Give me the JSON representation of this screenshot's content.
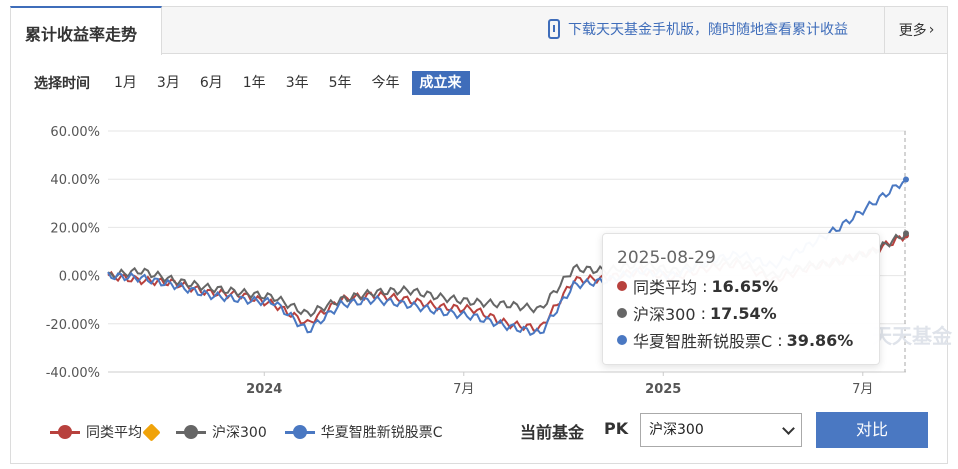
{
  "header": {
    "tab_title": "累计收益率走势",
    "promo_text": "下载天天基金手机版，随时随地查看累计收益",
    "more_label": "更多"
  },
  "range": {
    "label": "选择时间",
    "options": [
      "1月",
      "3月",
      "6月",
      "1年",
      "3年",
      "5年",
      "今年",
      "成立来"
    ],
    "active": "成立来"
  },
  "tooltip": {
    "date": "2025-08-29",
    "rows": [
      {
        "name": "同类平均",
        "value": "16.65%"
      },
      {
        "name": "沪深300",
        "value": "17.54%"
      },
      {
        "name": "华夏智胜新锐股票C",
        "value": "39.86%"
      }
    ]
  },
  "watermark": "天天基金",
  "legend": [
    "同类平均",
    "沪深300",
    "华夏智胜新锐股票C"
  ],
  "compare": {
    "label": "当前基金",
    "pk": "PK",
    "selected": "沪深300",
    "button": "对比"
  },
  "colors": {
    "category_avg": "#b8413d",
    "hs300": "#666666",
    "fund": "#4a78c2",
    "accent": "#3f6dba"
  },
  "chart_data": {
    "type": "line",
    "y_ticks": [
      "60.00%",
      "40.00%",
      "20.00%",
      "0.00%",
      "-20.00%",
      "-40.00%"
    ],
    "x_ticks": [
      "2024",
      "7月",
      "2025",
      "7月"
    ],
    "ylim": [
      -40,
      60
    ],
    "x": [
      "2023-08",
      "2023-09",
      "2023-10",
      "2023-11",
      "2023-12",
      "2024-01",
      "2024-02",
      "2024-03",
      "2024-04",
      "2024-05",
      "2024-06",
      "2024-07",
      "2024-08",
      "2024-09",
      "2024-10",
      "2024-11",
      "2024-12",
      "2025-01",
      "2025-02",
      "2025-03",
      "2025-04",
      "2025-05",
      "2025-06",
      "2025-07",
      "2025-08-29"
    ],
    "series": [
      {
        "name": "同类平均",
        "values": [
          0,
          -2,
          -3,
          -7,
          -8,
          -12,
          -20,
          -10,
          -8,
          -10,
          -13,
          -14,
          -20,
          -22,
          -2,
          -1,
          2,
          -1,
          3,
          5,
          -2,
          3,
          6,
          10,
          16.65
        ]
      },
      {
        "name": "沪深300",
        "values": [
          0,
          2,
          -2,
          -5,
          -7,
          -9,
          -16,
          -10,
          -7,
          -6,
          -9,
          -11,
          -12,
          -14,
          3,
          2,
          5,
          2,
          5,
          6,
          0,
          4,
          6,
          10,
          17.54
        ]
      },
      {
        "name": "华夏智胜新锐股票C",
        "values": [
          0,
          -1,
          -4,
          -8,
          -10,
          -11,
          -23,
          -12,
          -10,
          -12,
          -15,
          -17,
          -21,
          -24,
          -4,
          -2,
          2,
          0,
          6,
          9,
          4,
          12,
          20,
          30,
          39.86
        ]
      }
    ]
  }
}
